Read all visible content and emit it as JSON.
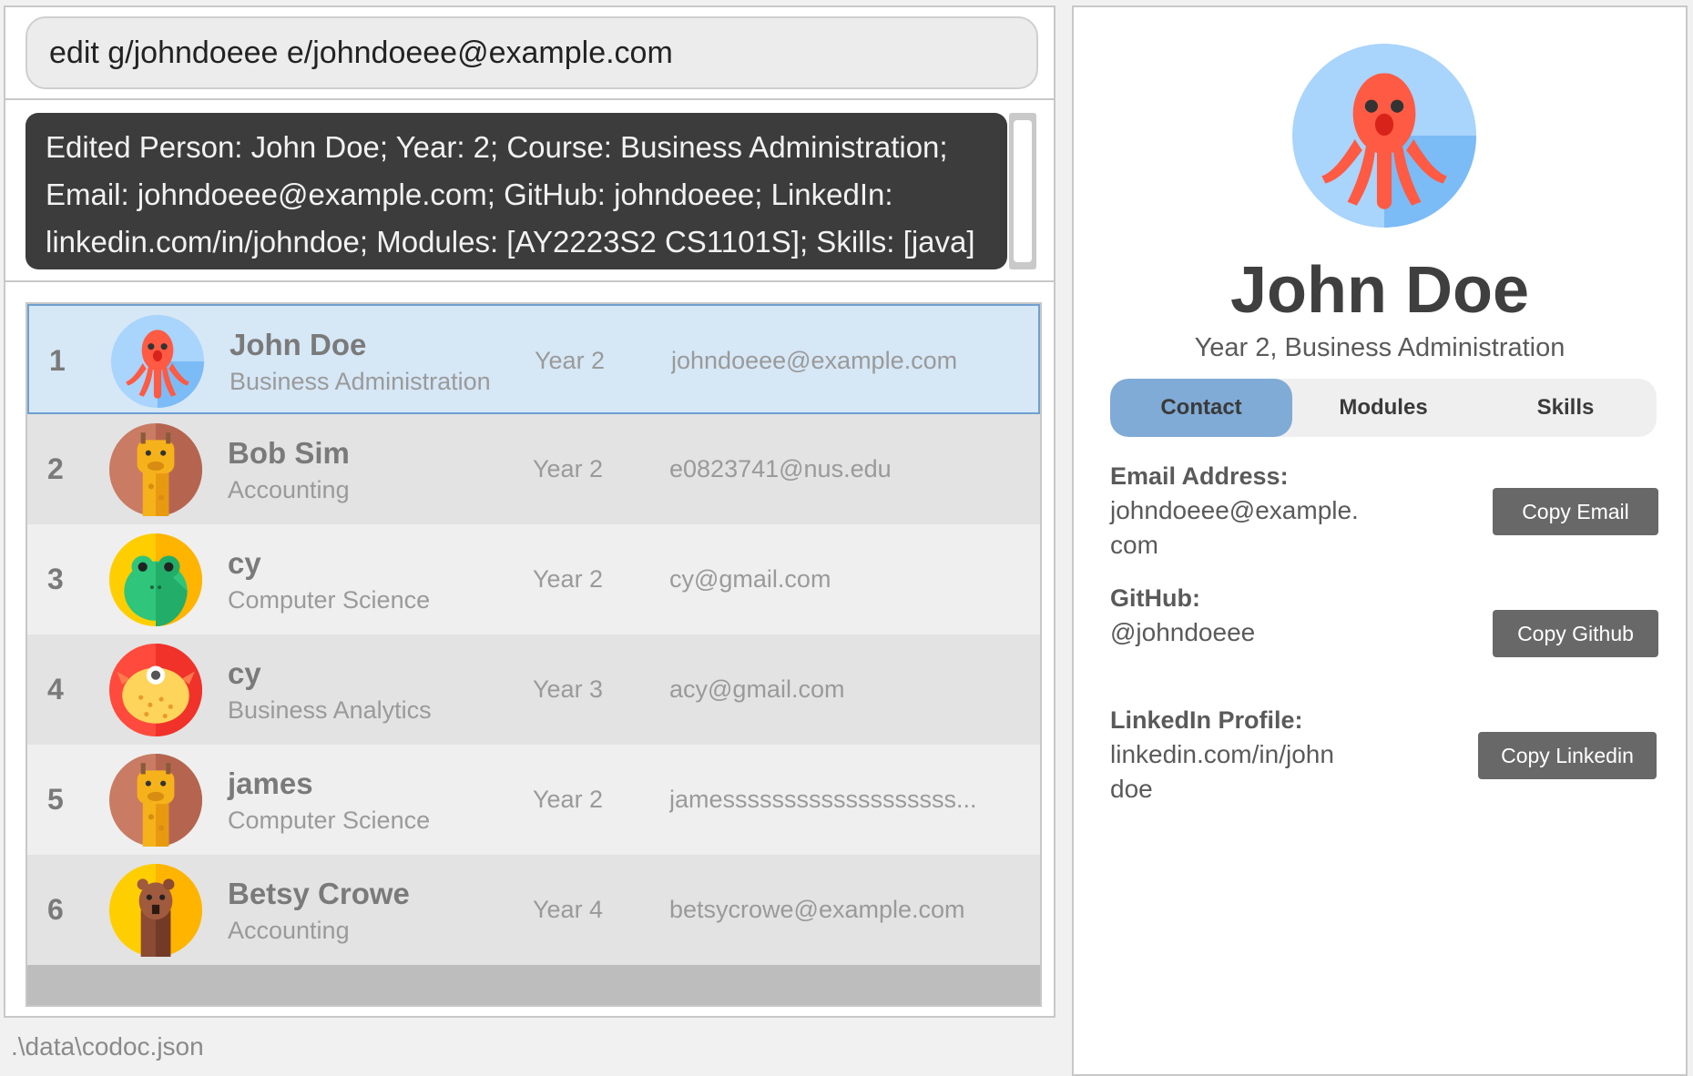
{
  "command": {
    "value": "edit g/johndoeee e/johndoeee@example.com"
  },
  "result": {
    "text": "Edited Person: John Doe; Year: 2; Course: Business Administration; Email: johndoeee@example.com; GitHub: johndoeee; LinkedIn: linkedin.com/in/johndoe; Modules: [AY2223S2 CS1101S]; Skills: [java]"
  },
  "persons": [
    {
      "index": "1",
      "name": "John Doe",
      "course": "Business Administration",
      "year": "Year 2",
      "email": "johndoeee@example.com",
      "avatar": "octopus-icon",
      "selected": true
    },
    {
      "index": "2",
      "name": "Bob Sim",
      "course": "Accounting",
      "year": "Year 2",
      "email": "e0823741@nus.edu",
      "avatar": "giraffe-icon",
      "selected": false
    },
    {
      "index": "3",
      "name": "cy",
      "course": "Computer Science",
      "year": "Year 2",
      "email": "cy@gmail.com",
      "avatar": "frog-icon",
      "selected": false
    },
    {
      "index": "4",
      "name": "cy",
      "course": "Business Analytics",
      "year": "Year 3",
      "email": "acy@gmail.com",
      "avatar": "pufferfish-icon",
      "selected": false
    },
    {
      "index": "5",
      "name": "james",
      "course": "Computer Science",
      "year": "Year 2",
      "email": "jamesssssssssssssssssss...",
      "avatar": "giraffe-icon",
      "selected": false
    },
    {
      "index": "6",
      "name": "Betsy Crowe",
      "course": "Accounting",
      "year": "Year 4",
      "email": "betsycrowe@example.com",
      "avatar": "llama-icon",
      "selected": false
    }
  ],
  "status_bar": {
    "path": ".\\data\\codoc.json"
  },
  "detail": {
    "name": "John Doe",
    "subtitle": "Year 2, Business Administration",
    "avatar": "octopus-icon",
    "tabs": [
      {
        "label": "Contact",
        "active": true
      },
      {
        "label": "Modules",
        "active": false
      },
      {
        "label": "Skills",
        "active": false
      }
    ],
    "email_label": "Email Address:",
    "email_value_line1": "johndoeee@example.",
    "email_value_line2": "com",
    "copy_email": "Copy Email",
    "github_label": "GitHub:",
    "github_value": "@johndoeee",
    "copy_github": "Copy Github",
    "linkedin_label": "LinkedIn Profile:",
    "linkedin_value_line1": "linkedin.com/in/john",
    "linkedin_value_line2": "doe",
    "copy_linkedin": "Copy Linkedin"
  },
  "colors": {
    "selected_row": "#d6e7f6",
    "active_tab": "#7fabd6",
    "result_bg": "#3c3c3c",
    "button": "#686868"
  }
}
